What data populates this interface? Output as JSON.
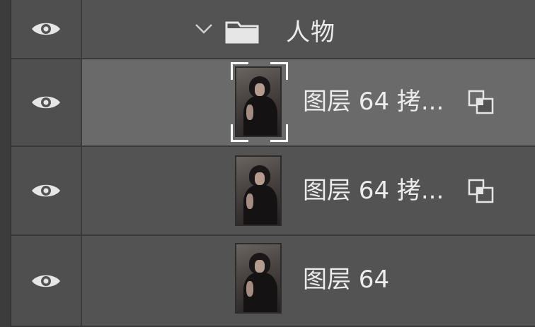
{
  "panel": "layers",
  "colors": {
    "panel_bg": "#535353",
    "selected_row_bg": "#6a6a6a",
    "divider": "#3a3a3a",
    "text": "#ececec"
  },
  "group": {
    "name": "人物",
    "expanded": true,
    "visible": true,
    "icons": [
      "eye-icon",
      "chevron-down-icon",
      "folder-icon"
    ]
  },
  "layers": [
    {
      "name": "图层 64 拷...",
      "visible": true,
      "selected": true,
      "smart_object": true
    },
    {
      "name": "图层 64 拷...",
      "visible": true,
      "selected": false,
      "smart_object": true
    },
    {
      "name": "图层 64",
      "visible": true,
      "selected": false,
      "smart_object": false
    }
  ]
}
